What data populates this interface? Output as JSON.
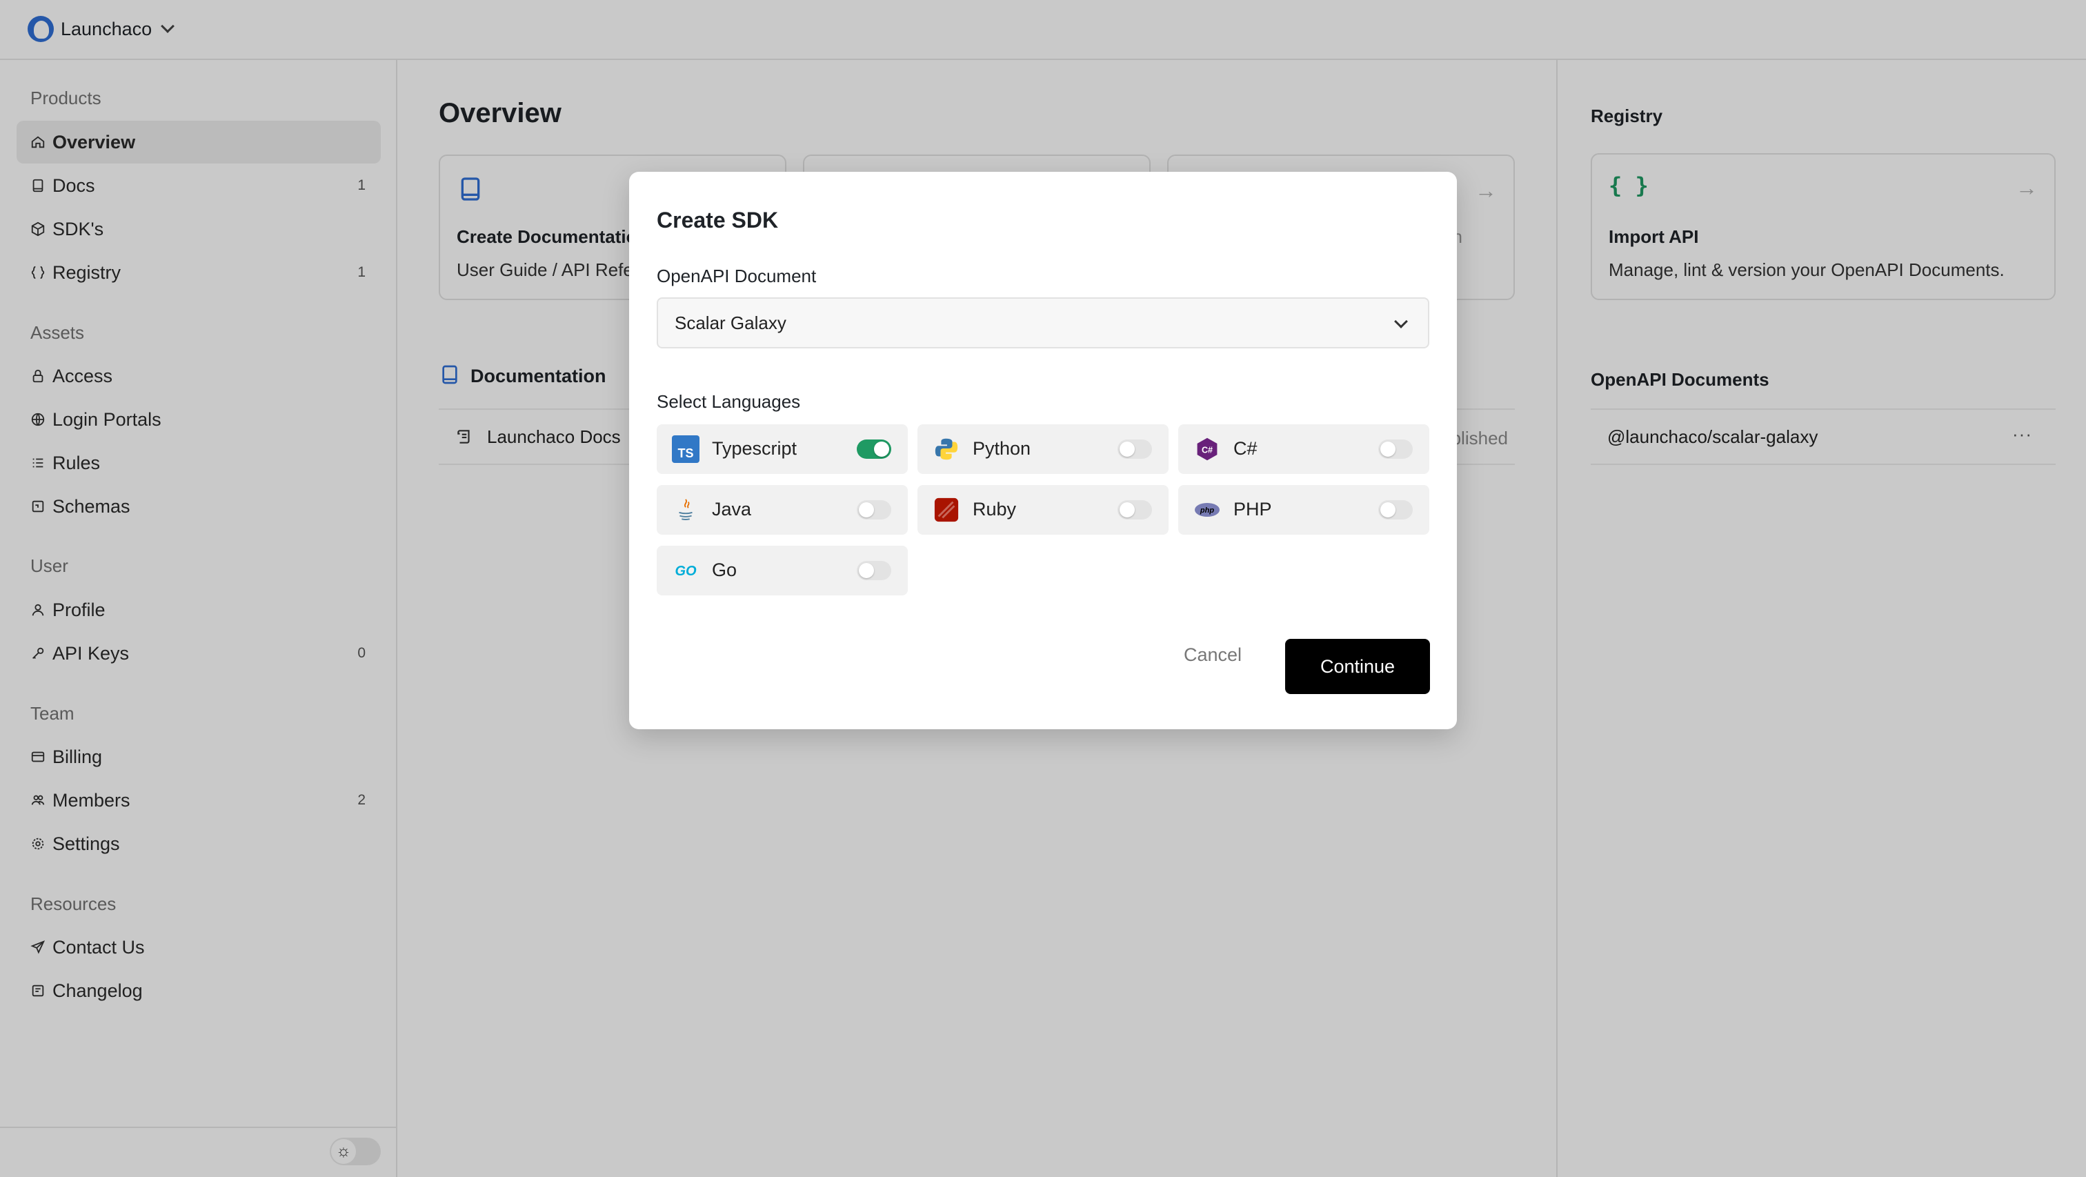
{
  "topbar": {
    "org_name": "Launchaco"
  },
  "sidebar": {
    "sections": [
      {
        "title": "Products"
      },
      {
        "title": "Assets"
      },
      {
        "title": "User"
      },
      {
        "title": "Team"
      },
      {
        "title": "Resources"
      }
    ],
    "items": [
      {
        "label": "Overview",
        "icon": "home-icon",
        "badge": ""
      },
      {
        "label": "Docs",
        "icon": "book-icon",
        "badge": "1"
      },
      {
        "label": "SDK's",
        "icon": "package-icon",
        "badge": ""
      },
      {
        "label": "Registry",
        "icon": "braces-icon",
        "badge": "1"
      },
      {
        "label": "Access",
        "icon": "lock-icon",
        "badge": ""
      },
      {
        "label": "Login Portals",
        "icon": "globe-icon",
        "badge": ""
      },
      {
        "label": "Rules",
        "icon": "list-icon",
        "badge": ""
      },
      {
        "label": "Schemas",
        "icon": "schema-icon",
        "badge": ""
      },
      {
        "label": "Profile",
        "icon": "user-icon",
        "badge": ""
      },
      {
        "label": "API Keys",
        "icon": "key-icon",
        "badge": "0"
      },
      {
        "label": "Billing",
        "icon": "card-icon",
        "badge": ""
      },
      {
        "label": "Members",
        "icon": "users-icon",
        "badge": "2"
      },
      {
        "label": "Settings",
        "icon": "gear-icon",
        "badge": ""
      },
      {
        "label": "Contact Us",
        "icon": "send-icon",
        "badge": ""
      },
      {
        "label": "Changelog",
        "icon": "changelog-icon",
        "badge": ""
      }
    ]
  },
  "main": {
    "title": "Overview",
    "cards": [
      {
        "title": "Create Documentation",
        "subtitle": "User Guide / API Reference"
      },
      {
        "title": "",
        "subtitle": ""
      },
      {
        "title": "",
        "subtitle": "n"
      }
    ],
    "docs_section": {
      "label": "Documentation",
      "rows": [
        {
          "name": "Launchaco Docs",
          "status": "Published"
        }
      ]
    }
  },
  "right_panel": {
    "registry_title": "Registry",
    "import_card": {
      "title": "Import API",
      "subtitle": "Manage, lint & version your OpenAPI Documents."
    },
    "docs_title": "OpenAPI Documents",
    "documents": [
      {
        "name": "@launchaco/scalar-galaxy"
      }
    ]
  },
  "modal": {
    "title": "Create SDK",
    "document_label": "OpenAPI Document",
    "document_value": "Scalar Galaxy",
    "languages_label": "Select Languages",
    "languages": [
      {
        "name": "Typescript",
        "enabled": true
      },
      {
        "name": "Python",
        "enabled": false
      },
      {
        "name": "C#",
        "enabled": false
      },
      {
        "name": "Java",
        "enabled": false
      },
      {
        "name": "Ruby",
        "enabled": false
      },
      {
        "name": "PHP",
        "enabled": false
      },
      {
        "name": "Go",
        "enabled": false
      }
    ],
    "cancel_label": "Cancel",
    "continue_label": "Continue"
  },
  "colors": {
    "accent_green": "#1f9a63",
    "primary_button": "#000000",
    "brand_blue": "#2f6fd6"
  }
}
